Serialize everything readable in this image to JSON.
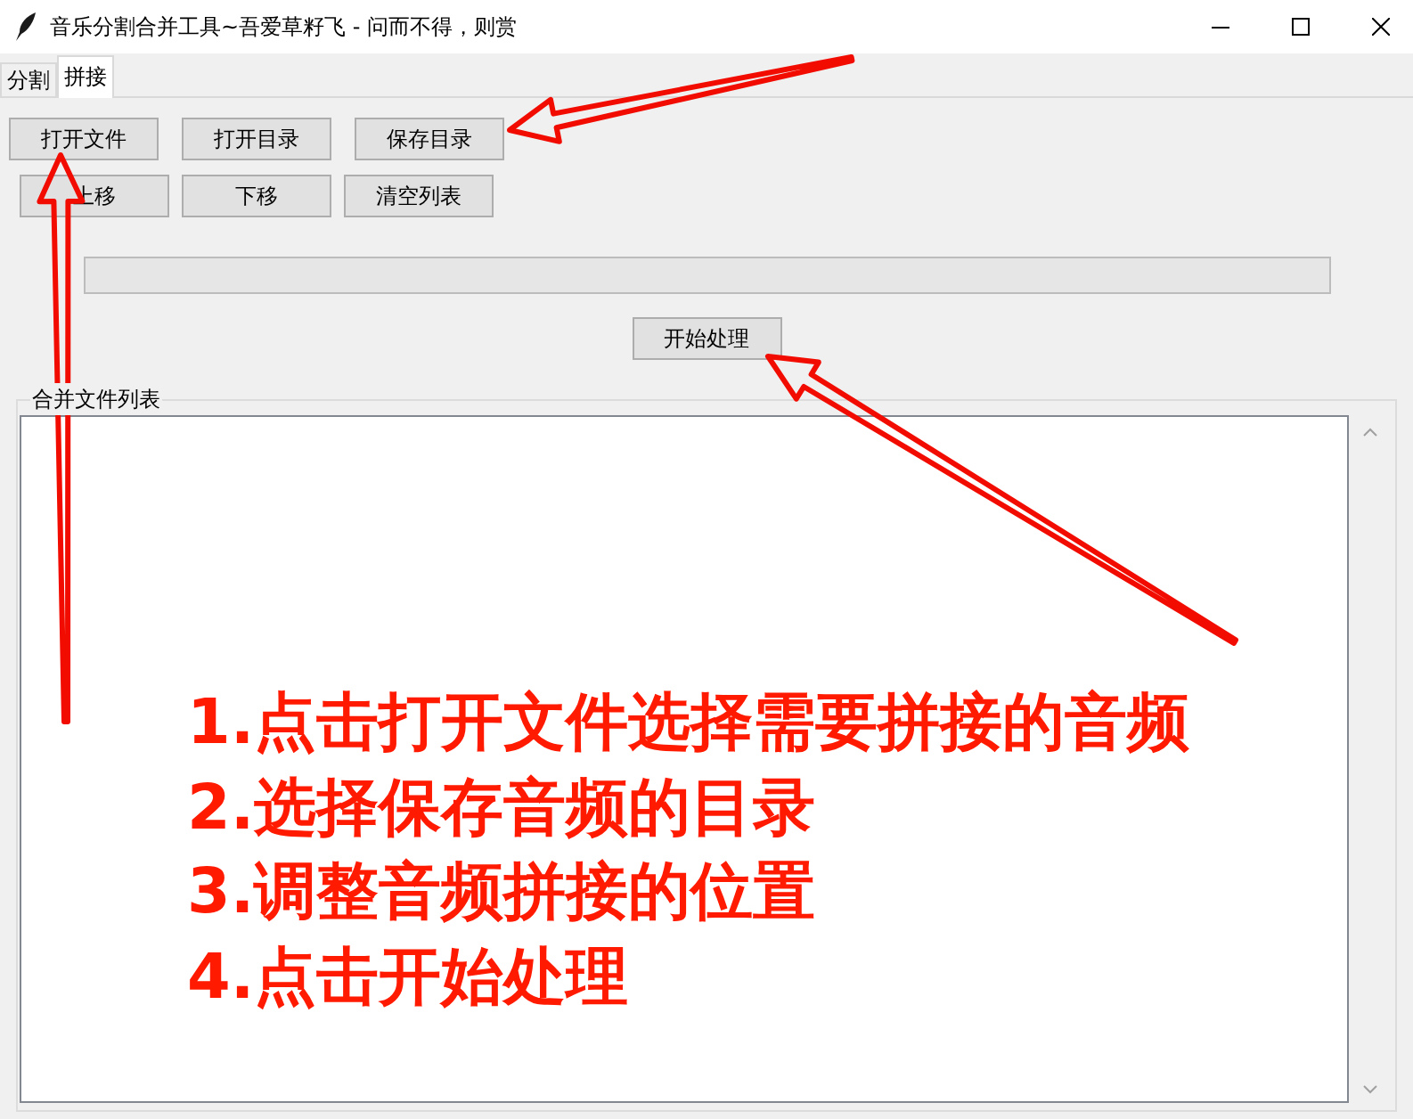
{
  "window": {
    "title": "音乐分割合并工具~吾爱草籽飞 - 问而不得，则赏"
  },
  "tabs": [
    {
      "label": "分割",
      "selected": false
    },
    {
      "label": "拼接",
      "selected": true
    }
  ],
  "button_rows": [
    [
      {
        "label": "打开文件"
      },
      {
        "label": "打开目录"
      },
      {
        "label": "保存目录"
      }
    ],
    [
      {
        "label": "上移"
      },
      {
        "label": "下移"
      },
      {
        "label": "清空列表"
      }
    ]
  ],
  "progress": {
    "level": 0
  },
  "start_button": {
    "label": "开始处理"
  },
  "file_list": {
    "title": "合并文件列表"
  },
  "annotation": {
    "steps": [
      "1.点击打开文件选择需要拼接的音频",
      "2.选择保存音频的目录",
      "3.调整音频拼接的位置",
      "4.点击开始处理"
    ]
  }
}
